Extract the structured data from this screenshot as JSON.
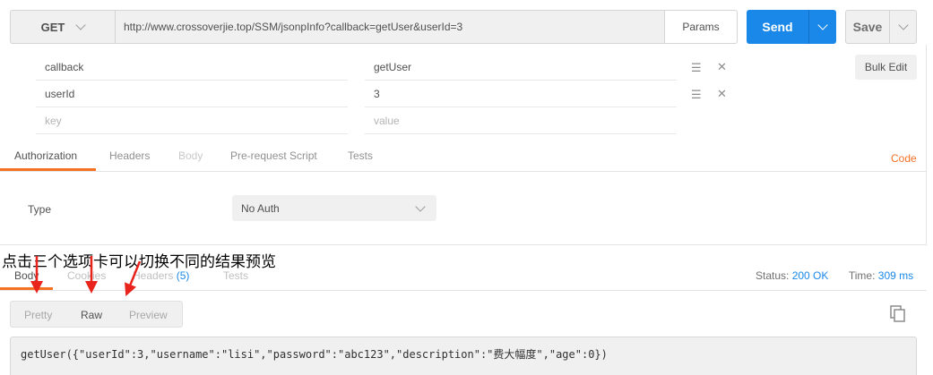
{
  "request": {
    "method": "GET",
    "url": "http://www.crossoverjie.top/SSM/jsonpInfo?callback=getUser&userId=3",
    "params_label": "Params",
    "send_label": "Send",
    "save_label": "Save",
    "bulk_edit_label": "Bulk Edit"
  },
  "params": [
    {
      "key": "callback",
      "value": "getUser"
    },
    {
      "key": "userId",
      "value": "3"
    }
  ],
  "params_placeholder": {
    "key": "key",
    "value": "value"
  },
  "request_tabs": [
    "Authorization",
    "Headers",
    "Body",
    "Pre-request Script",
    "Tests"
  ],
  "code_label": "Code",
  "auth": {
    "type_label": "Type",
    "selected": "No Auth"
  },
  "annotation": "点击三个选项卡可以切换不同的结果预览",
  "response_tabs": {
    "body": "Body",
    "cookies": "Cookies",
    "headers": "Headers",
    "headers_count": "(5)",
    "tests": "Tests"
  },
  "status": {
    "status_label": "Status:",
    "status_value": "200 OK",
    "time_label": "Time:",
    "time_value": "309 ms"
  },
  "view_buttons": [
    "Pretty",
    "Raw",
    "Preview"
  ],
  "response_body": "getUser({\"userId\":3,\"username\":\"lisi\",\"password\":\"abc123\",\"description\":\"费大幅度\",\"age\":0})",
  "colors": {
    "accent": "#f47023",
    "primary": "#1a88e8",
    "arrow": "#e8241c"
  }
}
